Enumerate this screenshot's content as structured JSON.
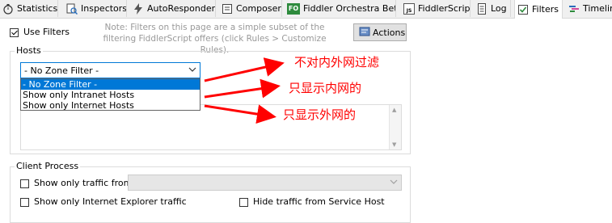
{
  "tabs": [
    {
      "label": "Statistics",
      "icon": "stopwatch-icon"
    },
    {
      "label": "Inspectors",
      "icon": "inspect-icon"
    },
    {
      "label": "AutoResponder",
      "icon": "lightning-icon"
    },
    {
      "label": "Composer",
      "icon": "composer-icon"
    },
    {
      "label": "Fiddler Orchestra Beta",
      "icon": "fo-icon",
      "badge": "FO"
    },
    {
      "label": "FiddlerScript",
      "icon": "script-icon",
      "badge": "JS"
    },
    {
      "label": "Log",
      "icon": "log-icon"
    },
    {
      "label": "Filters",
      "icon": "checkbox-icon",
      "active": true
    },
    {
      "label": "Timeline",
      "icon": "timeline-icon"
    }
  ],
  "use_filters": {
    "label": "Use Filters",
    "checked": true
  },
  "note": "Note: Filters on this page are a simple subset of the filtering FiddlerScript offers (click Rules > Customize Rules).",
  "actions_label": "Actions",
  "hosts": {
    "group_title": "Hosts",
    "selected": "- No Zone Filter -",
    "options": [
      "- No Zone Filter -",
      "Show only Intranet Hosts",
      "Show only Internet Hosts"
    ]
  },
  "client_process": {
    "group_title": "Client Process",
    "show_only_from": "Show only traffic from",
    "ie_traffic": "Show only Internet Explorer traffic",
    "hide_service_host": "Hide traffic from Service Host"
  },
  "annotations": {
    "no_filter": "不对内外网过滤",
    "intranet": "只显示内网的",
    "internet": "只显示外网的",
    "color": "#ff0000"
  },
  "colors": {
    "highlight": "#0078d7",
    "annotation": "#ff0000"
  }
}
